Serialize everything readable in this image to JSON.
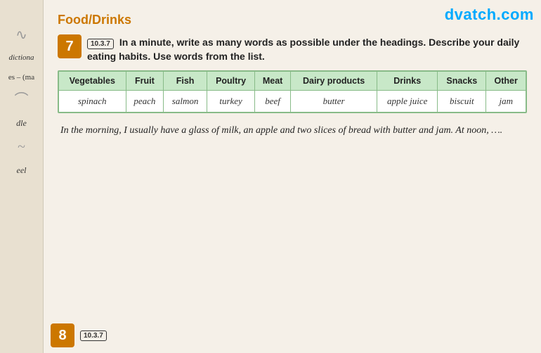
{
  "watermark": {
    "text": "dvatch.com"
  },
  "section": {
    "heading": "Food/Drinks"
  },
  "exercise7": {
    "number": "7",
    "tag": "10.3.7",
    "instruction": "In a minute, write as many words as possible under the headings. Describe your daily eating habits. Use words from the list."
  },
  "table": {
    "headers": [
      "Vegetables",
      "Fruit",
      "Fish",
      "Poultry",
      "Meat",
      "Dairy products",
      "Drinks",
      "Snacks",
      "Other"
    ],
    "rows": [
      [
        "spinach",
        "peach",
        "salmon",
        "turkey",
        "beef",
        "butter",
        "apple juice",
        "biscuit",
        "jam"
      ]
    ]
  },
  "sample_text": "In the morning, I usually have a glass of milk, an apple and two slices of bread with butter and jam. At noon, ….",
  "exercise8": {
    "number": "8",
    "tag": "10.3.7"
  },
  "sidebar": {
    "labels": [
      "dictiona",
      "es – (ma",
      "dle",
      "eel"
    ]
  }
}
